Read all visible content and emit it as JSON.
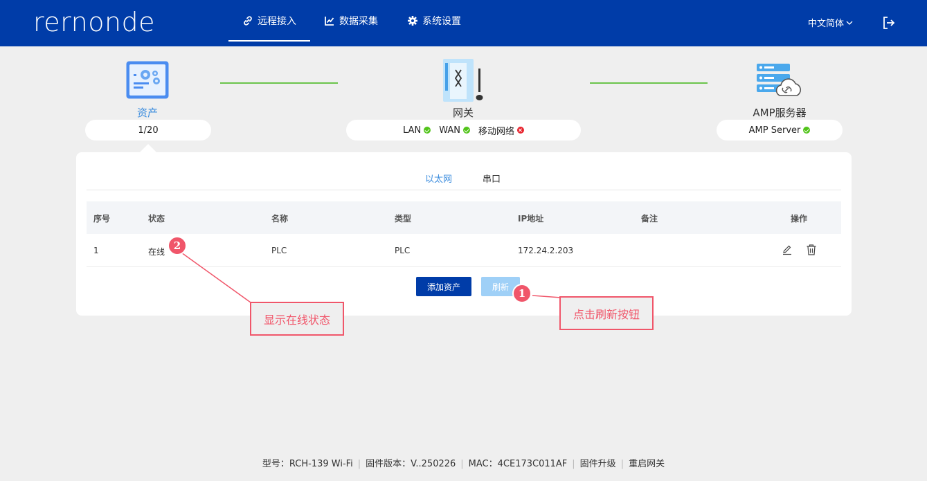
{
  "header": {
    "logo": "rernonde",
    "nav": [
      {
        "label": "远程接入",
        "icon": "link-icon",
        "active": true
      },
      {
        "label": "数据采集",
        "icon": "chart-icon",
        "active": false
      },
      {
        "label": "系统设置",
        "icon": "gear-icon",
        "active": false
      }
    ],
    "language": "中文简体",
    "logout_icon": "logout-icon"
  },
  "topology": {
    "asset": {
      "title": "资产",
      "count": "1/20"
    },
    "gateway": {
      "title": "网关",
      "statuses": [
        {
          "label": "LAN",
          "status": "ok"
        },
        {
          "label": "WAN",
          "status": "ok"
        },
        {
          "label": "移动网络",
          "status": "error"
        }
      ]
    },
    "server": {
      "title": "AMP服务器",
      "status_label": "AMP Server",
      "status": "ok"
    },
    "colors": {
      "ok": "#52c41a",
      "error": "#e8242e",
      "link": "#6ac44a",
      "accent": "#003ca8"
    }
  },
  "tabs": [
    {
      "label": "以太网",
      "active": true
    },
    {
      "label": "串口",
      "active": false
    }
  ],
  "table": {
    "headers": [
      "序号",
      "状态",
      "名称",
      "类型",
      "IP地址",
      "备注",
      "操作"
    ],
    "rows": [
      {
        "index": "1",
        "status": "在线",
        "name": "PLC",
        "type": "PLC",
        "ip": "172.24.2.203",
        "note": ""
      }
    ]
  },
  "buttons": {
    "add_asset": "添加资产",
    "refresh": "刷新"
  },
  "annotations": [
    {
      "number": "1",
      "text": "点击刷新按钮"
    },
    {
      "number": "2",
      "text": "显示在线状态"
    }
  ],
  "footer": {
    "model": "型号：RCH-139  Wi-Fi",
    "firmware": "固件版本：V..250226",
    "mac": "MAC：4CE173C011AF",
    "upgrade": "固件升级",
    "reboot": "重启网关"
  }
}
